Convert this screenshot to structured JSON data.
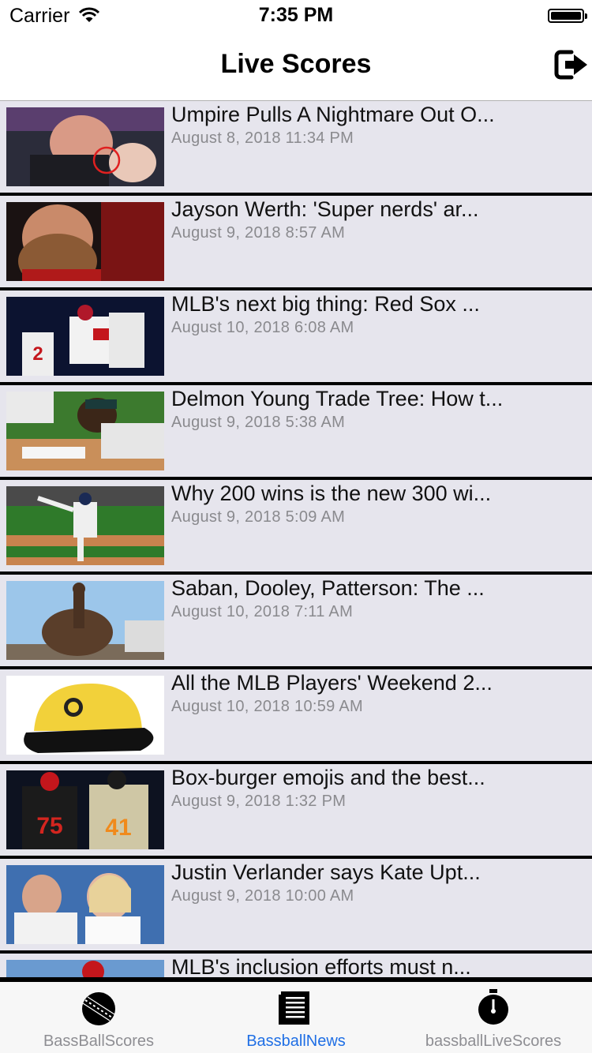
{
  "status_bar": {
    "carrier": "Carrier",
    "time": "7:35 PM"
  },
  "nav": {
    "title": "Live Scores",
    "right_icon": "logout-icon"
  },
  "news": [
    {
      "title": "Umpire Pulls A Nightmare Out O...",
      "date": "August 8, 2018 11:34 PM"
    },
    {
      "title": "Jayson Werth: 'Super nerds' ar...",
      "date": "August 9, 2018 8:57 AM"
    },
    {
      "title": "MLB's next big thing: Red Sox ...",
      "date": "August 10, 2018 6:08 AM"
    },
    {
      "title": "Delmon Young Trade Tree: How t...",
      "date": "August 9, 2018 5:38 AM"
    },
    {
      "title": "Why 200 wins is the new 300 wi...",
      "date": "August 9, 2018 5:09 AM"
    },
    {
      "title": "Saban, Dooley, Patterson: The ...",
      "date": "August 10, 2018 7:11 AM"
    },
    {
      "title": "All the MLB Players' Weekend 2...",
      "date": "August 10, 2018 10:59 AM"
    },
    {
      "title": "Box-burger emojis and the best...",
      "date": "August 9, 2018 1:32 PM"
    },
    {
      "title": "Justin Verlander says Kate Upt...",
      "date": "August 9, 2018 10:00 AM"
    },
    {
      "title": "MLB's inclusion efforts must n...",
      "date": ""
    }
  ],
  "tabs": [
    {
      "label": "BassBallScores",
      "icon": "baseball-icon",
      "active": false
    },
    {
      "label": "BassballNews",
      "icon": "newspaper-icon",
      "active": true
    },
    {
      "label": "bassballLiveScores",
      "icon": "stopwatch-icon",
      "active": false
    }
  ],
  "colors": {
    "accent": "#1f6fe5",
    "list_background": "#e6e5ed",
    "inactive_tab": "#8e8e93"
  }
}
